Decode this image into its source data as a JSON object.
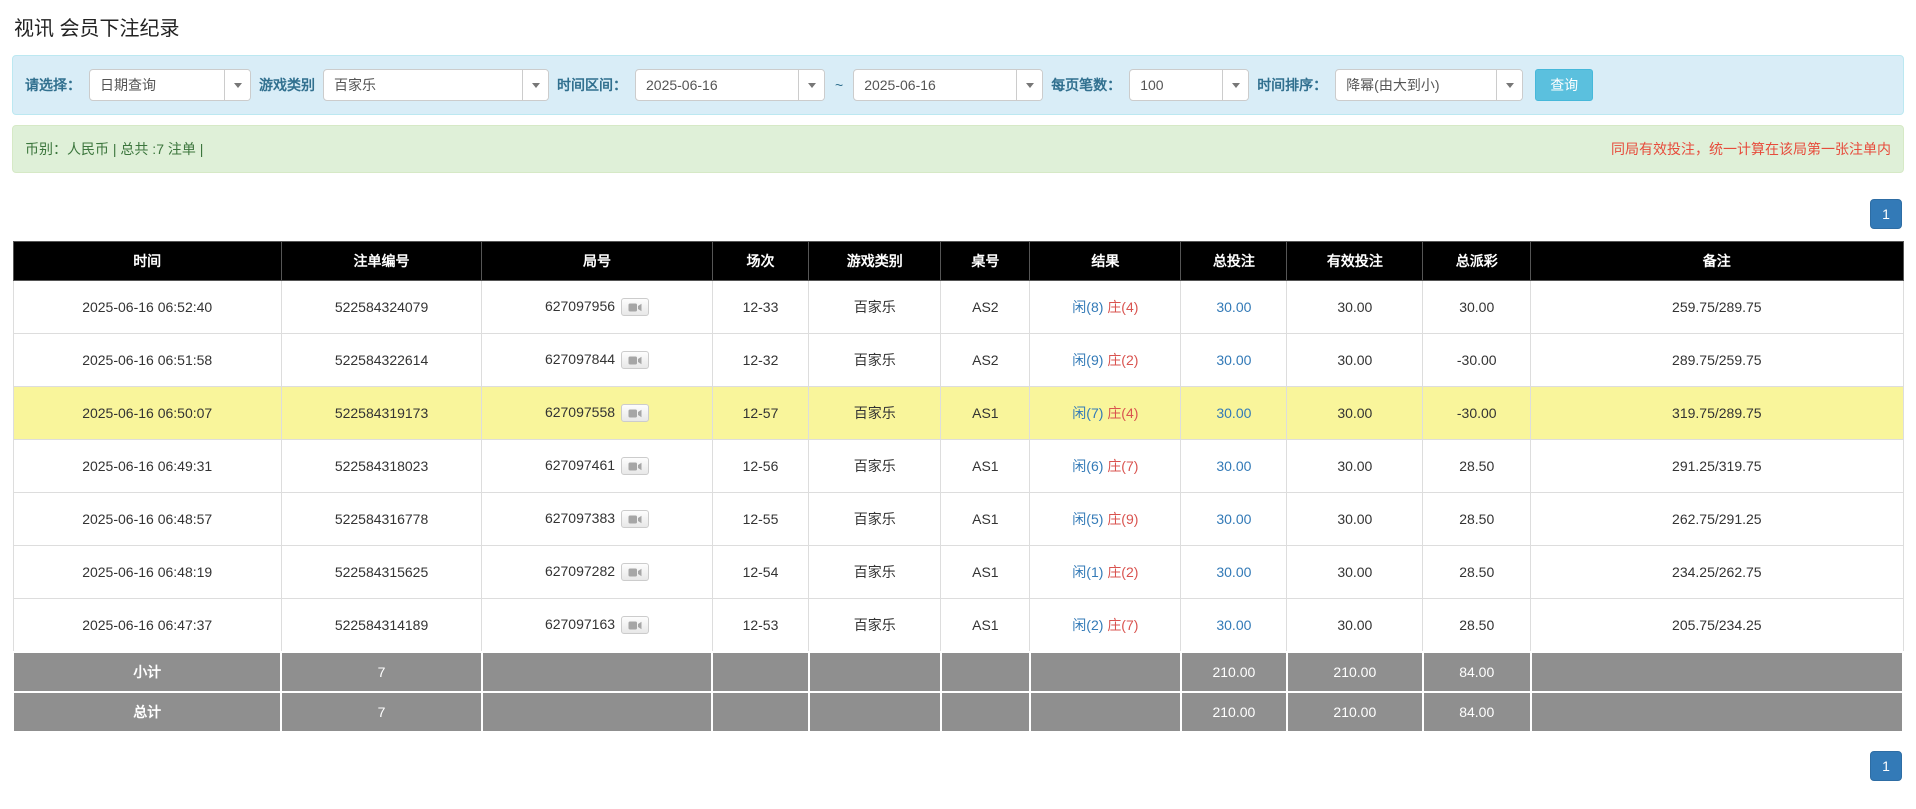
{
  "page": {
    "title": "视讯 会员下注纪录"
  },
  "filters": {
    "query_type": {
      "label": "请选择：",
      "value": "日期查询"
    },
    "game_type": {
      "label": "游戏类别",
      "value": "百家乐"
    },
    "date_range": {
      "label": "时间区间：",
      "from": "2025-06-16",
      "separator": "~",
      "to": "2025-06-16"
    },
    "page_size": {
      "label": "每页笔数：",
      "value": "100"
    },
    "sort": {
      "label": "时间排序：",
      "value": "降幂(由大到小)"
    },
    "query_button": "查询"
  },
  "summary": {
    "left": "币别：人民币 | 总共 :7 注单 |",
    "note": "同局有效投注，统一计算在该局第一张注单内"
  },
  "pagination": {
    "page": "1"
  },
  "table": {
    "headers": [
      "时间",
      "注单编号",
      "局号",
      "场次",
      "游戏类别",
      "桌号",
      "结果",
      "总投注",
      "有效投注",
      "总派彩",
      "备注"
    ],
    "rows": [
      {
        "time": "2025-06-16 06:52:40",
        "bet_id": "522584324079",
        "round_id": "627097956",
        "session": "12-33",
        "game": "百家乐",
        "table_no": "AS2",
        "result_player": "闲(8)",
        "result_banker": "庄(4)",
        "total_bet": "30.00",
        "valid_bet": "30.00",
        "payout": "30.00",
        "remark": "259.75/289.75",
        "highlight": false
      },
      {
        "time": "2025-06-16 06:51:58",
        "bet_id": "522584322614",
        "round_id": "627097844",
        "session": "12-32",
        "game": "百家乐",
        "table_no": "AS2",
        "result_player": "闲(9)",
        "result_banker": "庄(2)",
        "total_bet": "30.00",
        "valid_bet": "30.00",
        "payout": "-30.00",
        "remark": "289.75/259.75",
        "highlight": false
      },
      {
        "time": "2025-06-16 06:50:07",
        "bet_id": "522584319173",
        "round_id": "627097558",
        "session": "12-57",
        "game": "百家乐",
        "table_no": "AS1",
        "result_player": "闲(7)",
        "result_banker": "庄(4)",
        "total_bet": "30.00",
        "valid_bet": "30.00",
        "payout": "-30.00",
        "remark": "319.75/289.75",
        "highlight": true
      },
      {
        "time": "2025-06-16 06:49:31",
        "bet_id": "522584318023",
        "round_id": "627097461",
        "session": "12-56",
        "game": "百家乐",
        "table_no": "AS1",
        "result_player": "闲(6)",
        "result_banker": "庄(7)",
        "total_bet": "30.00",
        "valid_bet": "30.00",
        "payout": "28.50",
        "remark": "291.25/319.75",
        "highlight": false
      },
      {
        "time": "2025-06-16 06:48:57",
        "bet_id": "522584316778",
        "round_id": "627097383",
        "session": "12-55",
        "game": "百家乐",
        "table_no": "AS1",
        "result_player": "闲(5)",
        "result_banker": "庄(9)",
        "total_bet": "30.00",
        "valid_bet": "30.00",
        "payout": "28.50",
        "remark": "262.75/291.25",
        "highlight": false
      },
      {
        "time": "2025-06-16 06:48:19",
        "bet_id": "522584315625",
        "round_id": "627097282",
        "session": "12-54",
        "game": "百家乐",
        "table_no": "AS1",
        "result_player": "闲(1)",
        "result_banker": "庄(2)",
        "total_bet": "30.00",
        "valid_bet": "30.00",
        "payout": "28.50",
        "remark": "234.25/262.75",
        "highlight": false
      },
      {
        "time": "2025-06-16 06:47:37",
        "bet_id": "522584314189",
        "round_id": "627097163",
        "session": "12-53",
        "game": "百家乐",
        "table_no": "AS1",
        "result_player": "闲(2)",
        "result_banker": "庄(7)",
        "total_bet": "30.00",
        "valid_bet": "30.00",
        "payout": "28.50",
        "remark": "205.75/234.25",
        "highlight": false
      }
    ],
    "subtotal": {
      "label": "小计",
      "count": "7",
      "total_bet": "210.00",
      "valid_bet": "210.00",
      "payout": "84.00"
    },
    "grand_total": {
      "label": "总计",
      "count": "7",
      "total_bet": "210.00",
      "valid_bet": "210.00",
      "payout": "84.00"
    }
  }
}
